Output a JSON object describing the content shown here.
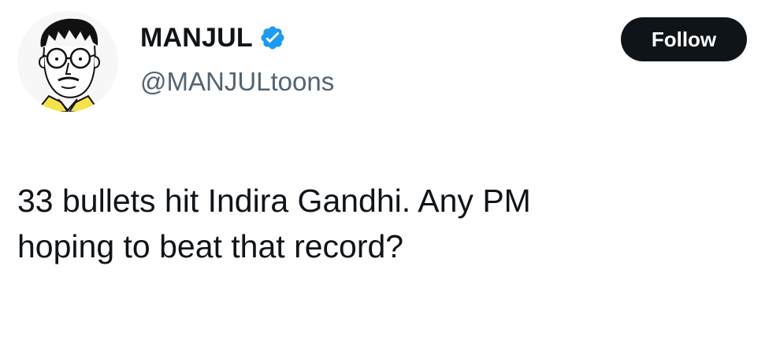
{
  "author": {
    "display_name": "MANJUL",
    "handle": "@MANJULtoons",
    "avatar": "cartoon-self-portrait-avatar",
    "verified_icon": "verified-badge-icon",
    "verified_color": "#1d9bf0"
  },
  "actions": {
    "follow_label": "Follow"
  },
  "tweet": {
    "lines": [
      "33 bullets hit Indira Gandhi. Any PM",
      "hoping to beat that record?"
    ]
  }
}
